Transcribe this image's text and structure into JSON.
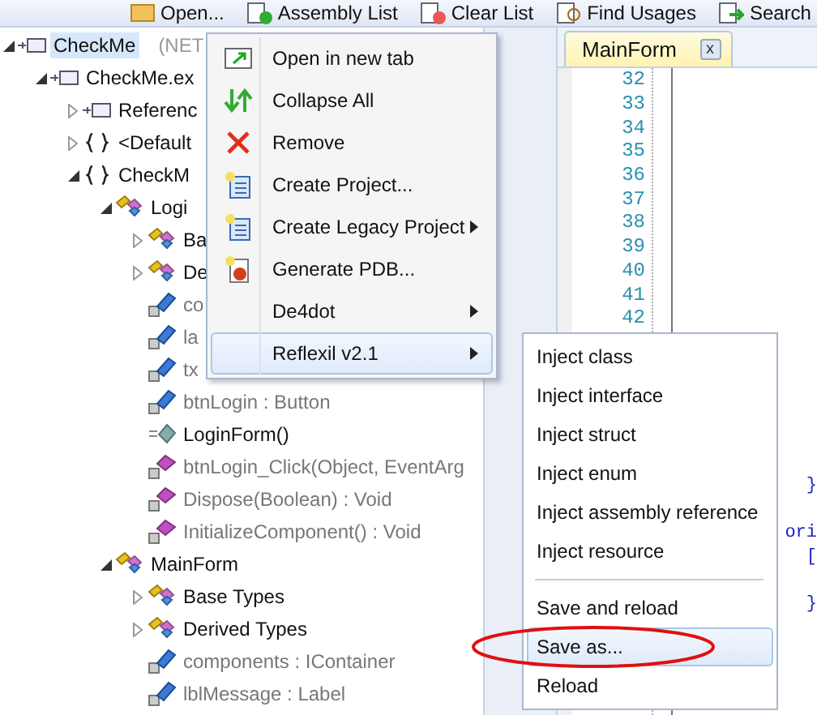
{
  "toolbar": [
    {
      "label": "Open..."
    },
    {
      "label": "Assembly List"
    },
    {
      "label": "Clear List"
    },
    {
      "label": "Find Usages"
    },
    {
      "label": "Search"
    }
  ],
  "tree": [
    {
      "kind": "assembly",
      "label": "CheckMe",
      "note": "(NET",
      "selected": true,
      "dimmed": false,
      "expanded": true,
      "children": [
        {
          "kind": "assembly",
          "label": "CheckMe.ex",
          "selected": false,
          "dimmed": false,
          "expanded": true,
          "children": [
            {
              "kind": "assembly",
              "label": "Referenc",
              "selected": false,
              "dimmed": false,
              "expanded": false
            },
            {
              "kind": "namespace",
              "label": "<Default",
              "selected": false,
              "dimmed": false,
              "expanded": false
            },
            {
              "kind": "namespace",
              "label": "CheckM",
              "selected": false,
              "dimmed": false,
              "expanded": true,
              "children": [
                {
                  "kind": "class",
                  "label": "Logi",
                  "selected": false,
                  "dimmed": false,
                  "expanded": true,
                  "children": [
                    {
                      "kind": "class",
                      "label": "Ba",
                      "selected": false,
                      "dimmed": false,
                      "expanded": false
                    },
                    {
                      "kind": "class",
                      "label": "De",
                      "selected": false,
                      "dimmed": false,
                      "expanded": false
                    },
                    {
                      "kind": "field",
                      "label": "co",
                      "selected": false,
                      "dimmed": true
                    },
                    {
                      "kind": "field",
                      "label": "la",
                      "selected": false,
                      "dimmed": true
                    },
                    {
                      "kind": "field",
                      "label": "tx",
                      "selected": false,
                      "dimmed": true
                    },
                    {
                      "kind": "field",
                      "label": "btnLogin : Button",
                      "selected": false,
                      "dimmed": true
                    },
                    {
                      "kind": "ctor",
                      "label": "LoginForm()",
                      "selected": false,
                      "dimmed": false
                    },
                    {
                      "kind": "method",
                      "label": "btnLogin_Click(Object, EventArg",
                      "selected": false,
                      "dimmed": true
                    },
                    {
                      "kind": "method",
                      "label": "Dispose(Boolean) : Void",
                      "selected": false,
                      "dimmed": true
                    },
                    {
                      "kind": "method",
                      "label": "InitializeComponent() : Void",
                      "selected": false,
                      "dimmed": true
                    }
                  ]
                },
                {
                  "kind": "class",
                  "label": "MainForm",
                  "selected": false,
                  "dimmed": false,
                  "expanded": true,
                  "children": [
                    {
                      "kind": "class",
                      "label": "Base Types",
                      "selected": false,
                      "dimmed": false,
                      "expanded": false
                    },
                    {
                      "kind": "class",
                      "label": "Derived Types",
                      "selected": false,
                      "dimmed": false,
                      "expanded": false
                    },
                    {
                      "kind": "field",
                      "label": "components : IContainer",
                      "selected": false,
                      "dimmed": true
                    },
                    {
                      "kind": "field",
                      "label": "lblMessage : Label",
                      "selected": false,
                      "dimmed": true
                    }
                  ]
                }
              ]
            }
          ]
        }
      ]
    }
  ],
  "editor": {
    "tab": {
      "label": "MainForm",
      "close": "x",
      "selected": true
    },
    "line_numbers": [
      "32",
      "33",
      "34",
      "35",
      "36",
      "37",
      "38",
      "39",
      "40",
      "41",
      "42"
    ],
    "code_fragments": [
      "}",
      "ori",
      "[",
      "}"
    ]
  },
  "context_menu": [
    {
      "label": "Open in new tab",
      "submenu": false,
      "selected": false
    },
    {
      "label": "Collapse All",
      "submenu": false,
      "selected": false
    },
    {
      "label": "Remove",
      "submenu": false,
      "selected": false
    },
    {
      "label": "Create Project...",
      "submenu": false,
      "selected": false
    },
    {
      "label": "Create Legacy Project",
      "submenu": true,
      "selected": false
    },
    {
      "label": "Generate PDB...",
      "submenu": false,
      "selected": false
    },
    {
      "label": "De4dot",
      "submenu": true,
      "selected": false
    },
    {
      "label": "Reflexil v2.1",
      "submenu": true,
      "selected": true
    }
  ],
  "submenu": [
    {
      "kind": "item",
      "label": "Inject class",
      "selected": false
    },
    {
      "kind": "item",
      "label": "Inject interface",
      "selected": false
    },
    {
      "kind": "item",
      "label": "Inject struct",
      "selected": false
    },
    {
      "kind": "item",
      "label": "Inject enum",
      "selected": false
    },
    {
      "kind": "item",
      "label": "Inject assembly reference",
      "selected": false
    },
    {
      "kind": "item",
      "label": "Inject resource",
      "selected": false
    },
    {
      "kind": "separator"
    },
    {
      "kind": "item",
      "label": "Save and reload",
      "selected": false
    },
    {
      "kind": "item",
      "label": "Save as...",
      "selected": true
    },
    {
      "kind": "item",
      "label": "Reload",
      "selected": false
    }
  ]
}
